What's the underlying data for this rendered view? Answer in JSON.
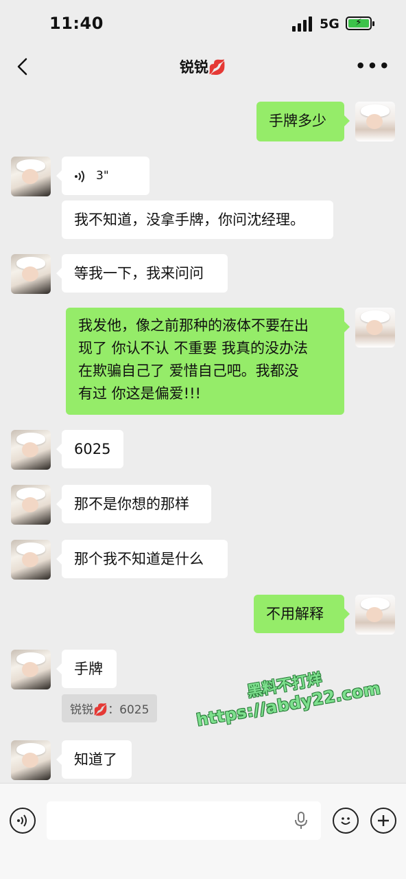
{
  "status": {
    "time": "11:40",
    "network": "5G",
    "battery_icon": "battery-charging-icon"
  },
  "header": {
    "title": "锐锐💋",
    "back_icon": "chevron-left-icon",
    "more_icon": "more-dots-icon"
  },
  "messages": [
    {
      "side": "right",
      "text": "手牌多少"
    },
    {
      "side": "left",
      "type": "voice",
      "duration": "3\""
    },
    {
      "side": "left",
      "text": "我不知道，没拿手牌，你问沈经理。"
    },
    {
      "side": "left",
      "text": "等我一下，我来问问"
    },
    {
      "side": "right",
      "lines": [
        "我发他，像之前那种的液体不要在出",
        "现了 你认不认 不重要 我真的没办法",
        "在欺骗自己了 爱惜自己吧。我都没",
        "有过 你这是偏爱!!!"
      ]
    },
    {
      "side": "left",
      "text": "6025"
    },
    {
      "side": "left",
      "text": "那不是你想的那样"
    },
    {
      "side": "left",
      "text": "那个我不知道是什么"
    },
    {
      "side": "right",
      "text": "不用解释"
    },
    {
      "side": "left",
      "text": "手牌"
    },
    {
      "side": "left",
      "text": "知道了"
    }
  ],
  "quote": {
    "text": "锐锐💋：6025"
  },
  "watermark": {
    "line1": "黑料不打烊",
    "line2": "https://abdy22.com"
  },
  "input_bar": {
    "placeholder": "",
    "voice_icon": "voice-input-icon",
    "mic_icon": "microphone-icon",
    "emoji_icon": "emoji-icon",
    "plus_icon": "plus-icon"
  },
  "colors": {
    "background": "#ededed",
    "sent_bubble": "#95ec69",
    "received_bubble": "#ffffff"
  }
}
